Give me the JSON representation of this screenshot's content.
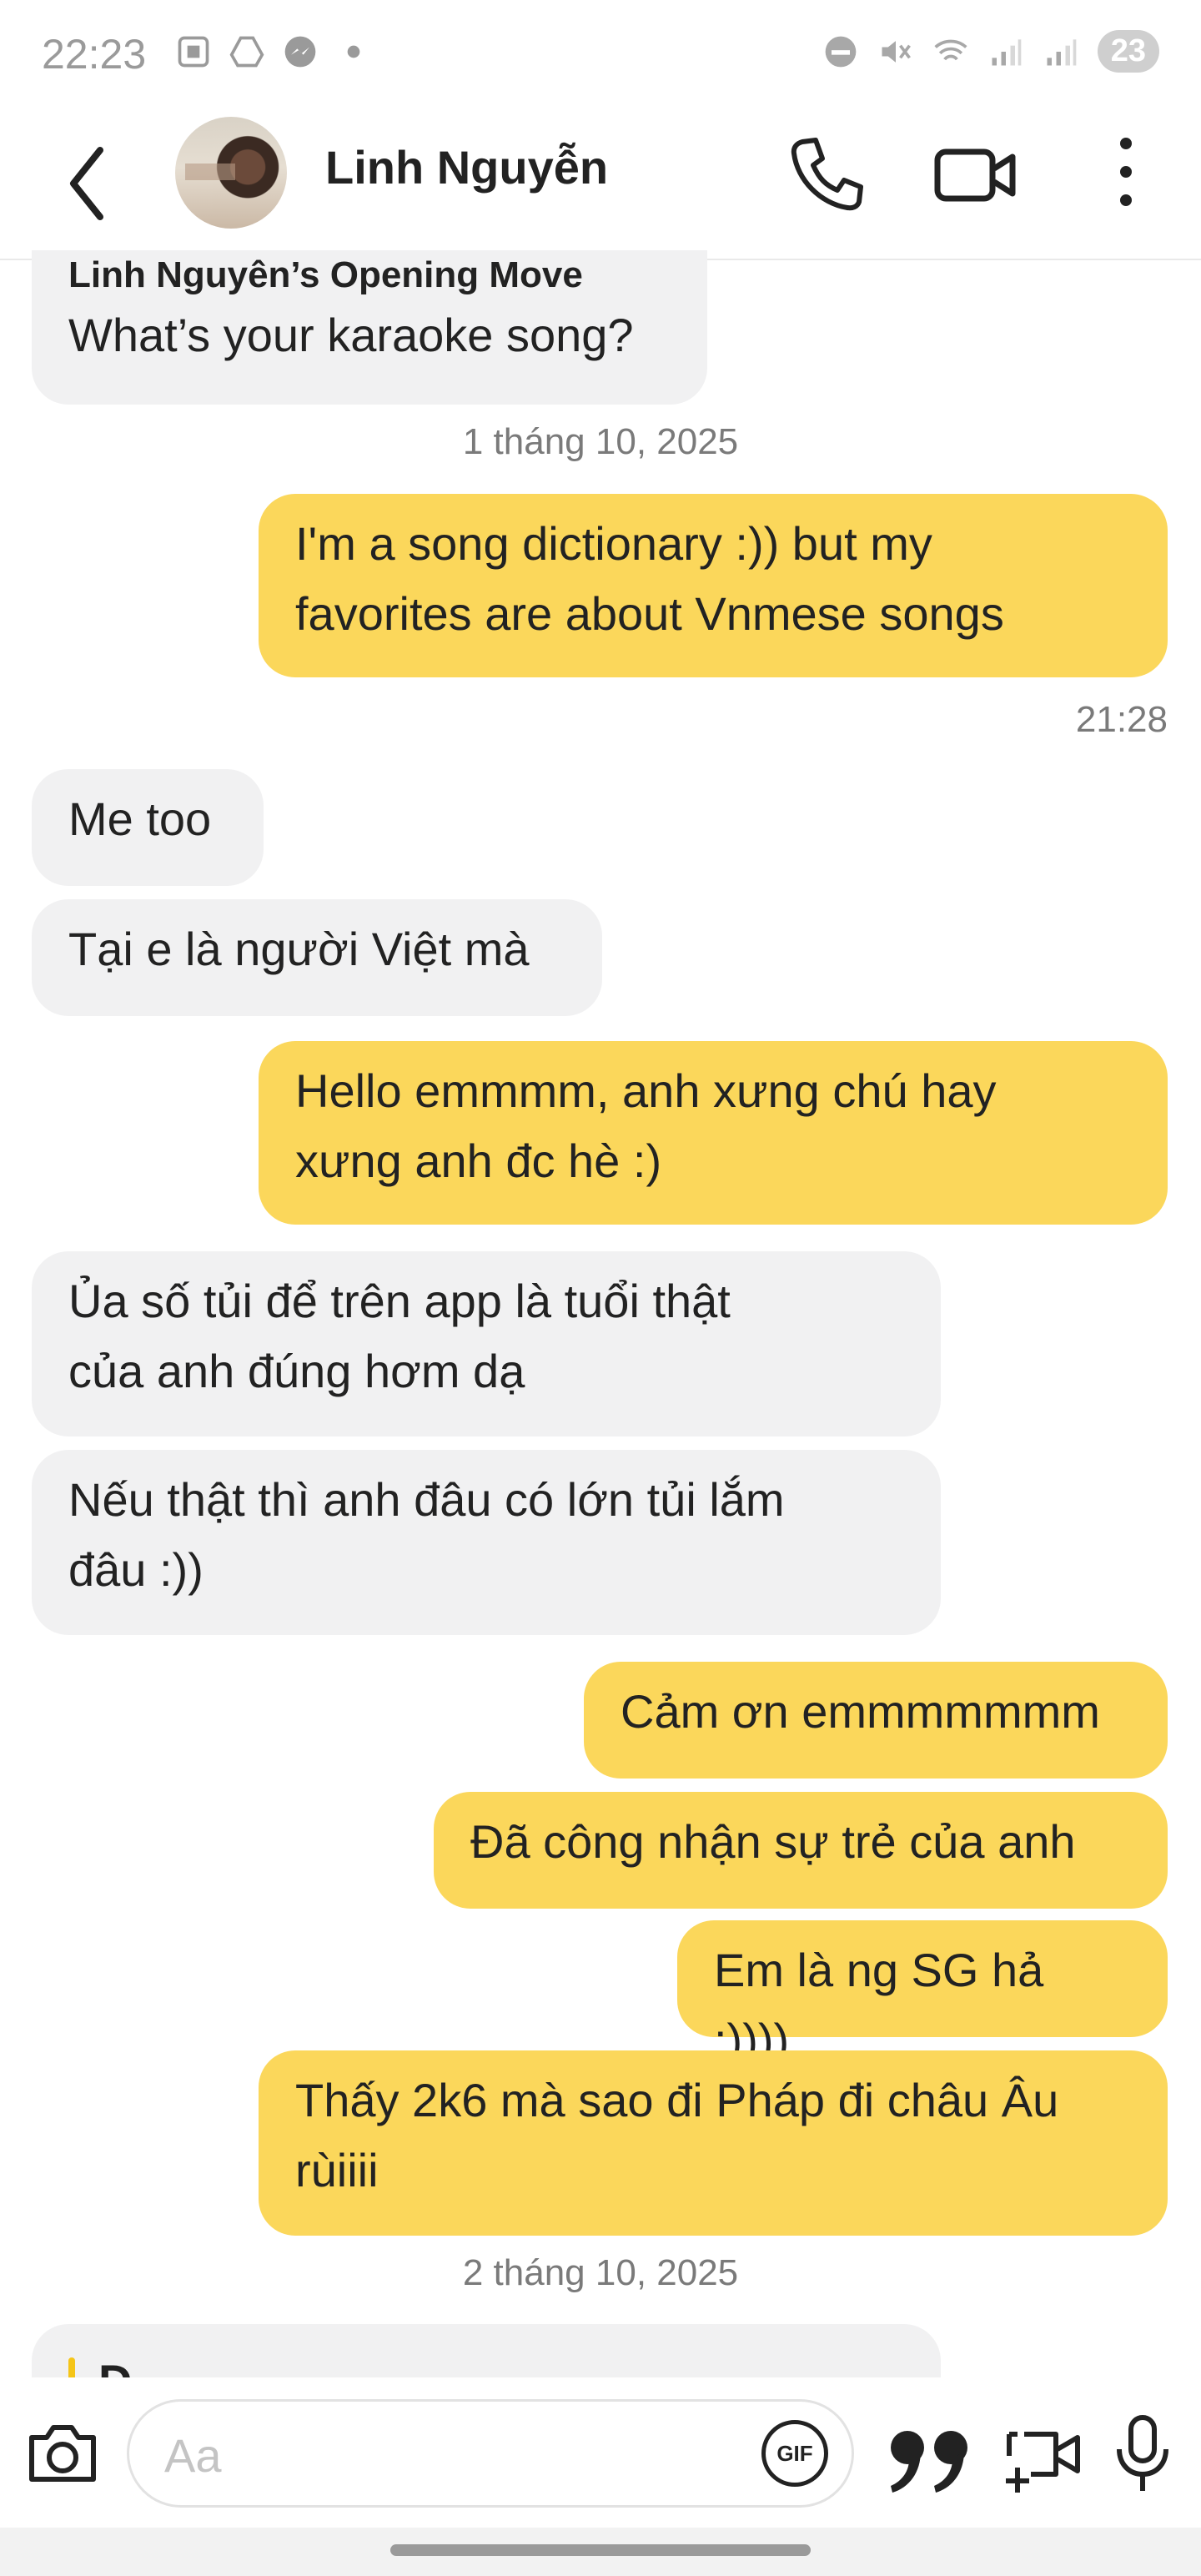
{
  "status_bar": {
    "time": "22:23",
    "battery": "23"
  },
  "header": {
    "contact_name": "Linh Nguyễn"
  },
  "messages": {
    "opening_title": "Linh Nguyên’s Opening Move",
    "opening_text": "What’s your karaoke song?",
    "date1": "1 tháng 10, 2025",
    "m1_l1": "I'm a song dictionary :)) but my",
    "m1_l2": "favorites are about Vnmese songs",
    "time1": "21:28",
    "m2": "Me too",
    "m3": "Tại e là người Việt mà",
    "m4_l1": "Hello emmmm, anh xưng chú hay",
    "m4_l2": "xưng anh đc hè :)",
    "m5_l1": "Ủa số tủi để trên app là tuổi thật",
    "m5_l2": "của anh đúng hơm dạ",
    "m6_l1": "Nếu thật thì anh đâu có lớn tủi lắm",
    "m6_l2": "đâu :))",
    "m7": "Cảm ơn emmmmmmm",
    "m8": "Đã công nhận sự trẻ của anh",
    "m9": "Em là ng SG hả :))))",
    "m10_l1": "Thấy 2k6 mà sao đi Pháp đi châu Âu",
    "m10_l2": "rùiiii",
    "date2": "2 tháng 10, 2025",
    "partial_letter": "D"
  },
  "composer": {
    "placeholder": "Aa",
    "gif_label": "GIF"
  },
  "colors": {
    "outgoing": "#fbd75b",
    "incoming": "#f1f1f2"
  }
}
